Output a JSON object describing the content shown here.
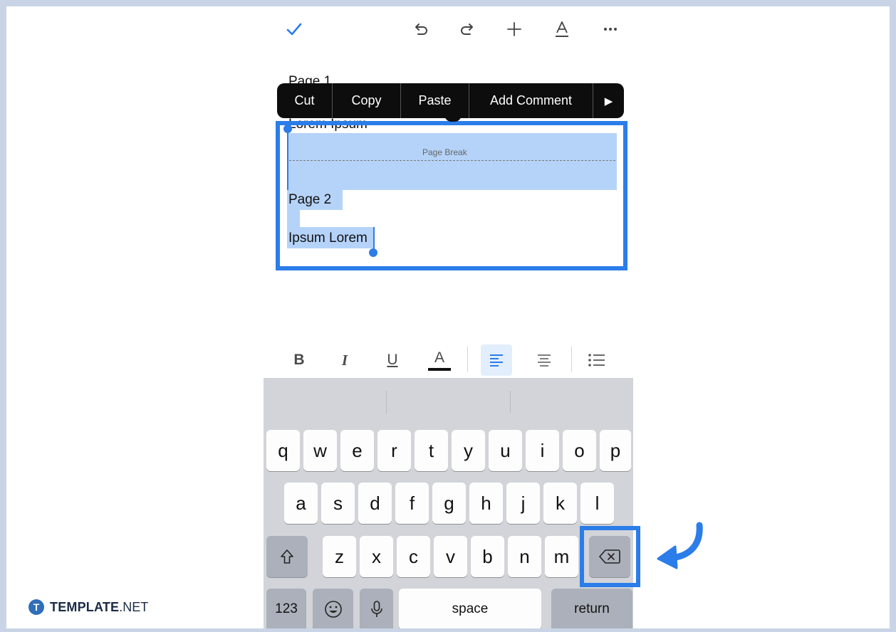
{
  "toolbar": {
    "icons": [
      "checkmark-icon",
      "undo-icon",
      "redo-icon",
      "plus-icon",
      "text-format-icon",
      "more-icon"
    ],
    "accent": "#2b7de9"
  },
  "document": {
    "page1_heading": "Page 1",
    "line1": "Lorem Ipsum",
    "page_break": "Page Break",
    "page2_heading": "Page 2",
    "line2": "Ipsum Lorem"
  },
  "context_menu": {
    "cut": "Cut",
    "copy": "Copy",
    "paste": "Paste",
    "add_comment": "Add Comment",
    "more": "▶"
  },
  "format_bar": {
    "bold": "B",
    "italic": "I",
    "underline": "U",
    "text_color": "A"
  },
  "keyboard": {
    "row1": [
      "q",
      "w",
      "e",
      "r",
      "t",
      "y",
      "u",
      "i",
      "o",
      "p"
    ],
    "row2": [
      "a",
      "s",
      "d",
      "f",
      "g",
      "h",
      "j",
      "k",
      "l"
    ],
    "row3": [
      "z",
      "x",
      "c",
      "v",
      "b",
      "n",
      "m"
    ],
    "numbers": "123",
    "space": "space",
    "return": "return"
  },
  "logo": {
    "badge": "T",
    "brand": "TEMPLATE",
    "tld": ".NET"
  },
  "colors": {
    "highlight_border": "#2b7de9",
    "selection_fill": "#b5d3f9",
    "arrow": "#2b7de9"
  }
}
